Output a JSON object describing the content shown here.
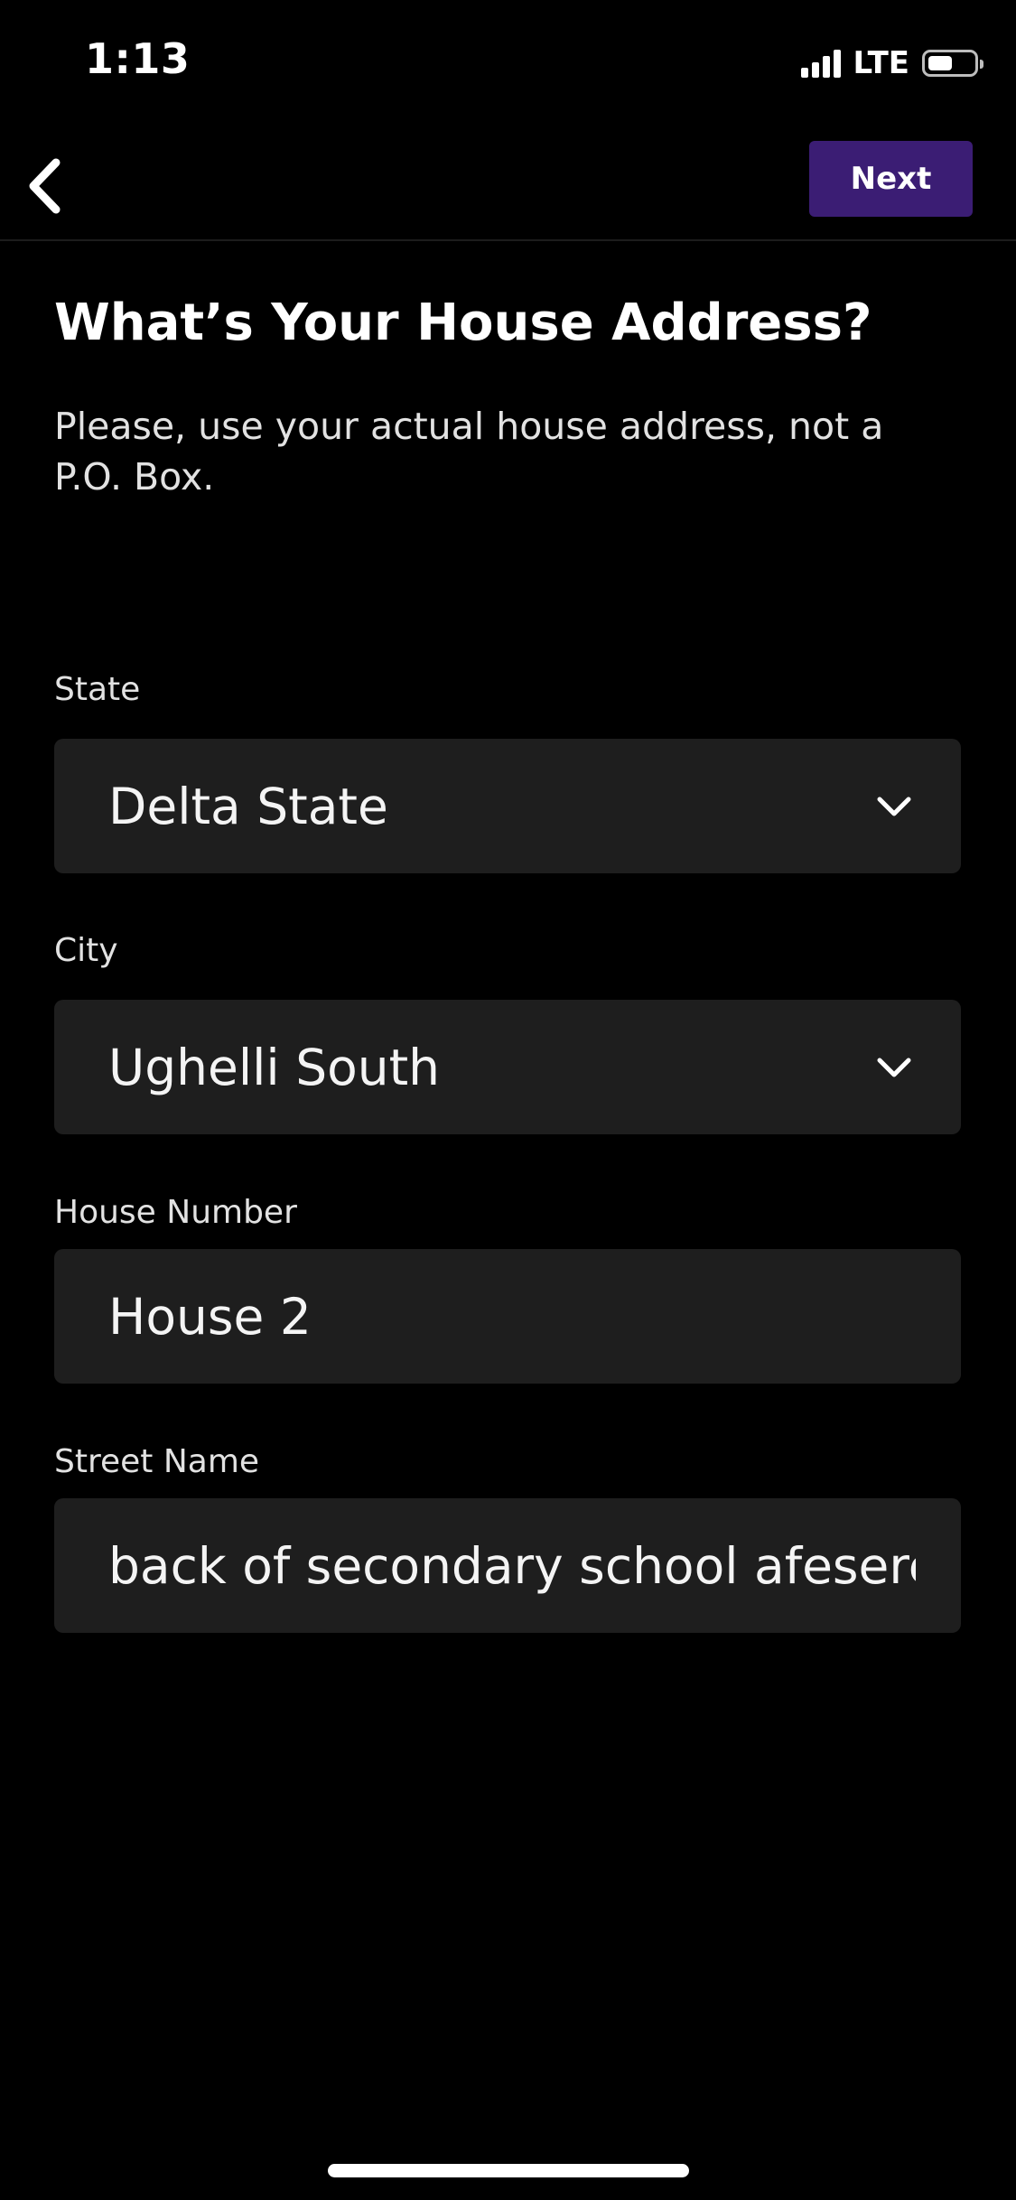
{
  "status_bar": {
    "time": "1:13",
    "network": "LTE",
    "battery_level": 0.55,
    "signal_bars": 4
  },
  "nav": {
    "back_icon": "chevron-left-icon",
    "next_label": "Next",
    "next_color": "#3b1d74"
  },
  "header": {
    "title": "What’s Your House Address?",
    "subtitle": "Please, use your actual house address, not a P.O. Box."
  },
  "form": {
    "state": {
      "label": "State",
      "value": "Delta State",
      "icon": "chevron-down-icon"
    },
    "city": {
      "label": "City",
      "value": "Ughelli South",
      "icon": "chevron-down-icon"
    },
    "house_number": {
      "label": "House Number",
      "value": "House 2"
    },
    "street_name": {
      "label": "Street Name",
      "value": "back of secondary school afesere"
    }
  },
  "colors": {
    "background": "#000000",
    "field_background": "#1e1e1e",
    "accent": "#3b1d74",
    "text": "#ffffff"
  }
}
